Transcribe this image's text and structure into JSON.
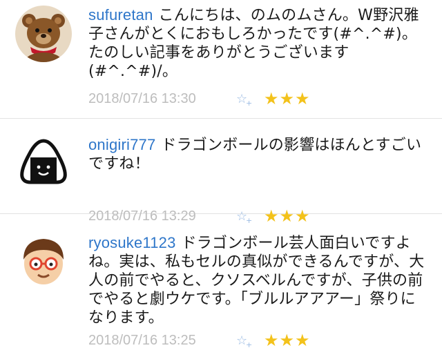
{
  "comments": [
    {
      "username": "sufuretan",
      "text": "こんにちは、のムのムさん。W野沢雅子さんがとくにおもしろかったです(#^.^#)。たのしい記事をありがとうございます(#^.^#)/。",
      "timestamp": "2018/07/16 13:30",
      "like_icon": "star-plus-icon",
      "rating_stars": "★★★"
    },
    {
      "username": "onigiri777",
      "text": "ドラゴンボールの影響はほんとすごいですね！",
      "timestamp": "2018/07/16 13:29",
      "like_icon": "star-plus-icon",
      "rating_stars": "★★★"
    },
    {
      "username": "ryosuke1123",
      "text": "ドラゴンボール芸人面白いですよね。実は、私もセルの真似ができるんですが、大人の前でやると、クソスベルんですが、子供の前でやると劇ウケです。「ブルルアアアー」祭りになります。",
      "timestamp": "2018/07/16 13:25",
      "like_icon": "star-plus-icon",
      "rating_stars": "★★★"
    }
  ],
  "colors": {
    "username": "#2e76c9",
    "timestamp": "#bdbdbd",
    "like_icon": "#9bbbe3",
    "stars": "#f3c21b",
    "divider": "#e2e2e2"
  }
}
